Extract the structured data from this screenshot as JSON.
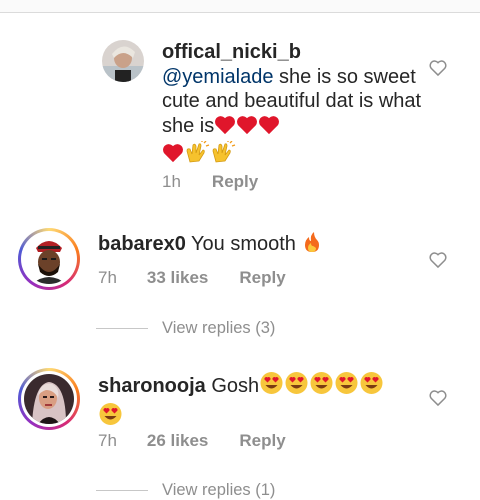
{
  "comments": [
    {
      "username": "offical_nicki_b",
      "mention": "@yemialade",
      "text": " she is so sweet cute and beautiful dat is what she is",
      "time": "1h",
      "likes": "",
      "reply_label": "Reply",
      "emoji": [
        "red-heart",
        "red-heart",
        "red-heart",
        "red-heart",
        "clapping-hands",
        "clapping-hands"
      ]
    },
    {
      "username": "babarex0",
      "text": " You smooth ",
      "time": "7h",
      "likes": "33 likes",
      "reply_label": "Reply",
      "emoji": [
        "fire"
      ],
      "view_replies": "View replies (3)"
    },
    {
      "username": "sharonooja",
      "text": " Gosh",
      "time": "7h",
      "likes": "26 likes",
      "reply_label": "Reply",
      "emoji": [
        "heart-eyes",
        "heart-eyes",
        "heart-eyes",
        "heart-eyes",
        "heart-eyes",
        "heart-eyes"
      ],
      "view_replies": "View replies (1)"
    }
  ],
  "colors": {
    "text": "#262626",
    "secondary": "#8e8e8e",
    "mention": "#003569",
    "heart_red": "#e0162b"
  }
}
